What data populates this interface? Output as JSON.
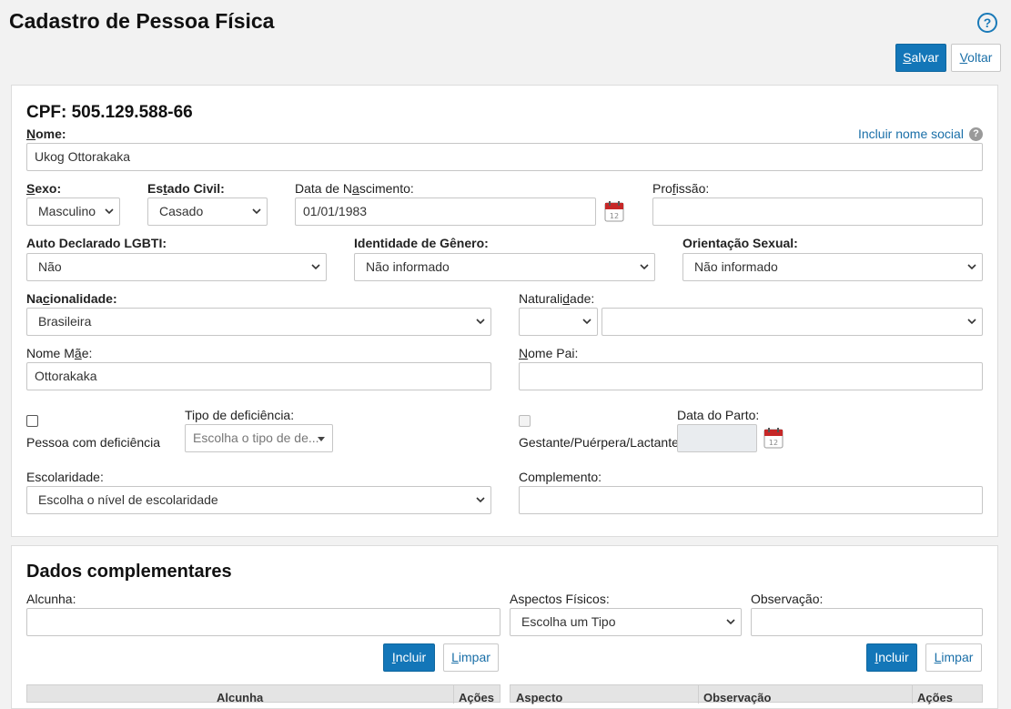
{
  "header": {
    "title": "Cadastro de Pessoa Física",
    "help_icon": "?"
  },
  "toolbar": {
    "save_label": "Salvar",
    "save_key": "S",
    "save_rest": "alvar",
    "back_label": "Voltar",
    "back_key": "V",
    "back_rest": "oltar"
  },
  "person": {
    "cpf": "CPF: 505.129.588-66",
    "nome_label_key": "N",
    "nome_label_rest": "ome:",
    "nome_value": "Ukog Ottorakaka",
    "social_name_link": "Incluir nome social",
    "sexo_label_key": "S",
    "sexo_label_rest": "exo:",
    "sexo_value": "Masculino",
    "estado_civil_label_pre": "Es",
    "estado_civil_label_key": "t",
    "estado_civil_label_rest": "ado Civil:",
    "estado_civil_value": "Casado",
    "nascimento_label_pre": "Data de N",
    "nascimento_label_key": "a",
    "nascimento_label_rest": "scimento:",
    "nascimento_value": "01/01/1983",
    "profissao_label_pre": "Pro",
    "profissao_label_key": "f",
    "profissao_label_rest": "issão:",
    "profissao_value": "",
    "lgbti_label": "Auto Declarado LGBTI:",
    "lgbti_value": "Não",
    "genero_label": "Identidade de Gênero:",
    "genero_value": "Não informado",
    "orientacao_label": "Orientação Sexual:",
    "orientacao_value": "Não informado",
    "nacionalidade_label_pre": "Na",
    "nacionalidade_label_key": "c",
    "nacionalidade_label_rest": "ionalidade:",
    "nacionalidade_value": "Brasileira",
    "naturalidade_label_pre": "Naturali",
    "naturalidade_label_key": "d",
    "naturalidade_label_rest": "ade:",
    "naturalidade_uf_value": "",
    "naturalidade_city_value": "",
    "mae_label_pre": "Nome M",
    "mae_label_key": "ã",
    "mae_label_rest": "e:",
    "mae_value": "Ottorakaka",
    "pai_label_key": "N",
    "pai_label_rest": "ome Pai:",
    "pai_value": "",
    "deficiencia_checkbox_label": "Pessoa com deficiência",
    "tipo_deficiencia_label": "Tipo de deficiência:",
    "tipo_deficiencia_placeholder": "Escolha o tipo de de...",
    "gestante_label": "Gestante/Puérpera/Lactante",
    "parto_label": "Data do Parto:",
    "parto_value": "",
    "escolaridade_label": "Escolaridade:",
    "escolaridade_value": "Escolha o nível de escolaridade",
    "complemento_label": "Complemento:",
    "complemento_value": ""
  },
  "complementares": {
    "title": "Dados complementares",
    "alcunha_label": "Alcunha:",
    "alcunha_value": "",
    "aspectos_label": "Aspectos Físicos:",
    "aspectos_value": "Escolha um Tipo",
    "observacao_label": "Observação:",
    "observacao_value": "",
    "incluir_key": "I",
    "incluir_rest": "ncluir",
    "limpar_key": "L",
    "limpar_rest": "impar",
    "table_left_headers": [
      "Alcunha",
      "Ações"
    ],
    "table_right_headers": [
      "Aspecto",
      "Observação",
      "Ações"
    ]
  },
  "colors": {
    "primary": "#1376b8",
    "link": "#1a6fa8",
    "background": "#f2f2f2"
  }
}
